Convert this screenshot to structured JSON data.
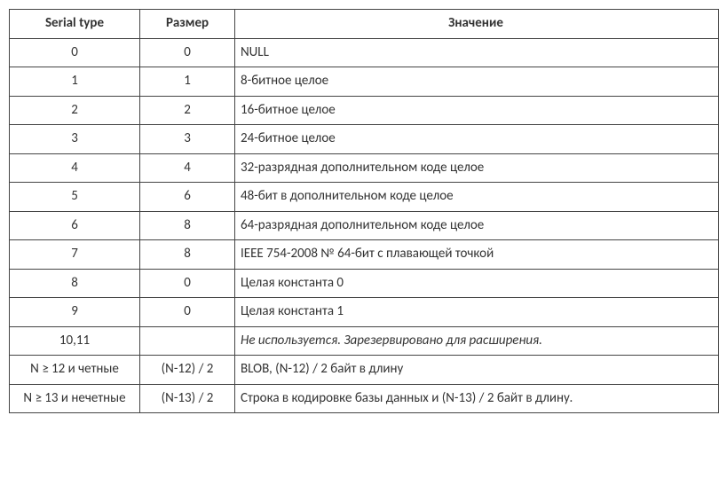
{
  "headers": {
    "serial": "Serial type",
    "size": "Размер",
    "value": "Значение"
  },
  "rows": [
    {
      "serial": "0",
      "size": "0",
      "value": "NULL",
      "italic": false
    },
    {
      "serial": "1",
      "size": "1",
      "value": "8-битное целое",
      "italic": false
    },
    {
      "serial": "2",
      "size": "2",
      "value": "16-битное целое",
      "italic": false
    },
    {
      "serial": "3",
      "size": "3",
      "value": "24-битное целое",
      "italic": false
    },
    {
      "serial": "4",
      "size": "4",
      "value": "32-разрядная дополнительном коде целое",
      "italic": false
    },
    {
      "serial": "5",
      "size": "6",
      "value": "48-бит в дополнительном коде целое",
      "italic": false
    },
    {
      "serial": "6",
      "size": "8",
      "value": "64-разрядная дополнительном коде целое",
      "italic": false
    },
    {
      "serial": "7",
      "size": "8",
      "value": "IEEE 754-2008 № 64-бит с плавающей точкой",
      "italic": false
    },
    {
      "serial": "8",
      "size": "0",
      "value": "Целая константа 0",
      "italic": false
    },
    {
      "serial": "9",
      "size": "0",
      "value": "Целая константа 1",
      "italic": false
    },
    {
      "serial": "10,11",
      "size": "",
      "value": "Не используется. Зарезервировано для расширения.",
      "italic": true
    },
    {
      "serial": "N ≥ 12 и четные",
      "size": "(N-12) / 2",
      "value": "BLOB, (N-12) / 2 байт в длину",
      "italic": false
    },
    {
      "serial": "N ≥ 13 и нечетные",
      "size": "(N-13) / 2",
      "value": "Строка в кодировке базы данных и (N-13) / 2 байт в длину.",
      "italic": false
    }
  ]
}
